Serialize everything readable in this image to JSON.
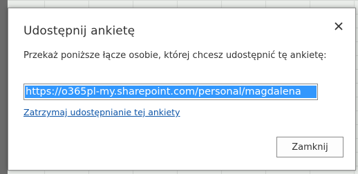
{
  "dialog": {
    "title": "Udostępnij ankietę",
    "close_icon": "close-icon",
    "description": "Przekaż poniższe łącze osobie, której chcesz udostępnić tę ankietę:",
    "link_value": "https://o365pl-my.sharepoint.com/personal/magdalena",
    "stop_sharing_label": "Zatrzymaj udostępnianie tej ankiety",
    "close_button_label": "Zamknij"
  },
  "colors": {
    "selection": "#3297fd",
    "link": "#0f56a8",
    "text": "#333333"
  }
}
